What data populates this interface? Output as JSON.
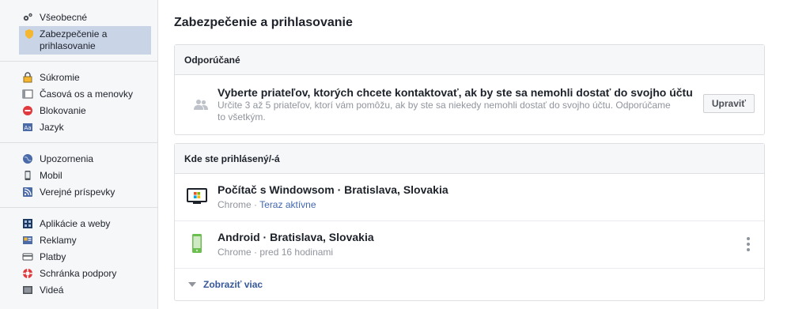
{
  "sidebar": {
    "groups": [
      [
        {
          "label": "Všeobecné",
          "icon": "gears-icon",
          "active": false
        },
        {
          "label": "Zabezpečenie a prihlasovanie",
          "icon": "shield-icon",
          "active": true
        }
      ],
      [
        {
          "label": "Súkromie",
          "icon": "lock-icon"
        },
        {
          "label": "Časová os a menovky",
          "icon": "timeline-icon"
        },
        {
          "label": "Blokovanie",
          "icon": "block-icon"
        },
        {
          "label": "Jazyk",
          "icon": "language-icon"
        }
      ],
      [
        {
          "label": "Upozornenia",
          "icon": "globe-icon"
        },
        {
          "label": "Mobil",
          "icon": "mobile-icon"
        },
        {
          "label": "Verejné príspevky",
          "icon": "rss-icon"
        }
      ],
      [
        {
          "label": "Aplikácie a weby",
          "icon": "apps-icon"
        },
        {
          "label": "Reklamy",
          "icon": "ads-icon"
        },
        {
          "label": "Platby",
          "icon": "card-icon"
        },
        {
          "label": "Schránka podpory",
          "icon": "lifebuoy-icon"
        },
        {
          "label": "Videá",
          "icon": "video-icon"
        }
      ]
    ]
  },
  "main": {
    "title": "Zabezpečenie a prihlasovanie",
    "recommended": {
      "header": "Odporúčané",
      "title": "Vyberte priateľov, ktorých chcete kontaktovať, ak by ste sa nemohli dostať do svojho účtu",
      "description": "Určite 3 až 5 priateľov, ktorí vám pomôžu, ak by ste sa niekedy nemohli dostať do svojho účtu. Odporúčame to všetkým.",
      "button": "Upraviť"
    },
    "sessions": {
      "header": "Kde ste prihlásený/-á",
      "items": [
        {
          "device": "windows-pc-icon",
          "title": "Počítač s Windowsom · Bratislava, Slovakia",
          "browser": "Chrome",
          "separator": " · ",
          "status": "Teraz aktívne",
          "status_active": true
        },
        {
          "device": "android-phone-icon",
          "title": "Android · Bratislava, Slovakia",
          "browser": "Chrome",
          "separator": " · ",
          "status": "pred 16 hodinami",
          "status_active": false
        }
      ],
      "show_more": "Zobraziť viac"
    }
  },
  "colors": {
    "link": "#365899",
    "active_status": "#4267b2",
    "sidebar_active": "#c9d4e6"
  }
}
